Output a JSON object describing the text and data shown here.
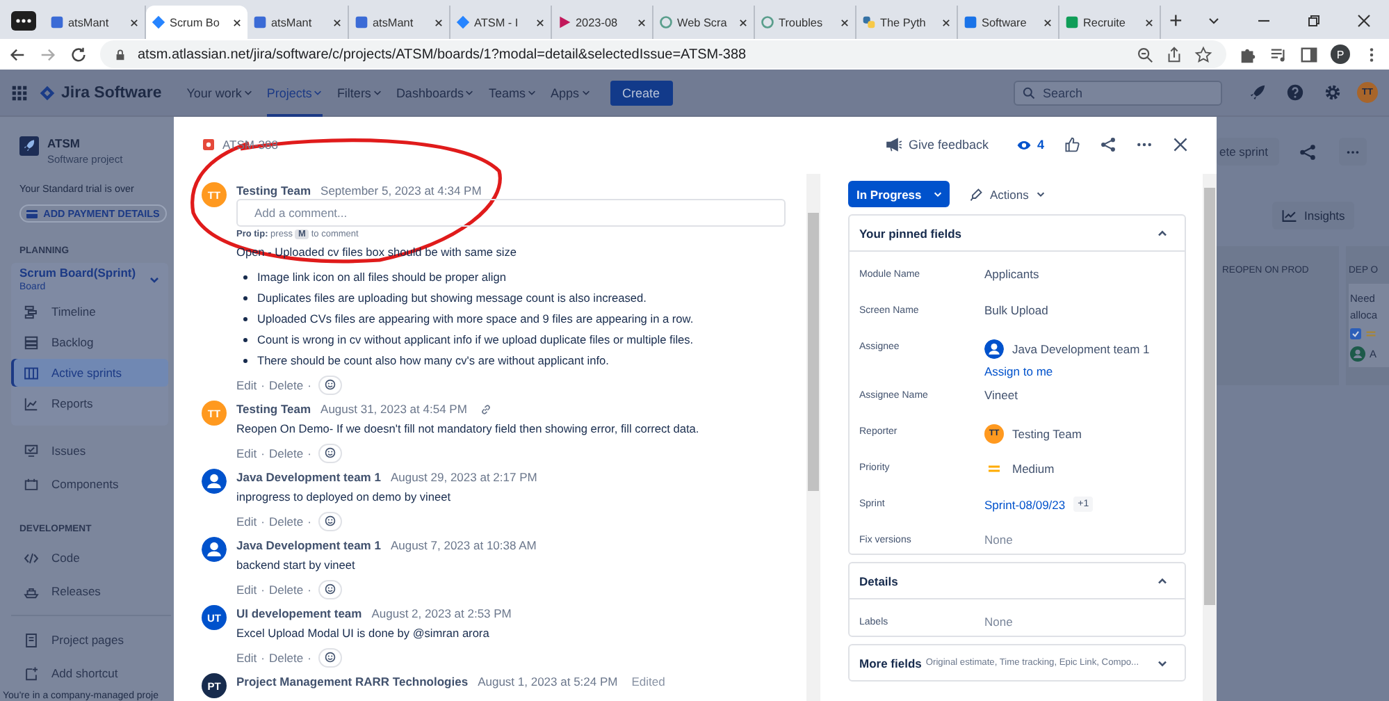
{
  "browser": {
    "tabs": [
      {
        "title": "atsMant",
        "kind": "m",
        "selected": false
      },
      {
        "title": "Scrum Bo",
        "kind": "jira",
        "selected": true
      },
      {
        "title": "atsMant",
        "kind": "m",
        "selected": false
      },
      {
        "title": "atsMant",
        "kind": "m",
        "selected": false
      },
      {
        "title": "ATSM - I",
        "kind": "jira",
        "selected": false
      },
      {
        "title": "2023-08",
        "kind": "triangle",
        "selected": false
      },
      {
        "title": "Web Scra",
        "kind": "knot",
        "selected": false
      },
      {
        "title": "Troubles",
        "kind": "knot",
        "selected": false
      },
      {
        "title": "The Pyth",
        "kind": "python",
        "selected": false
      },
      {
        "title": "Software",
        "kind": "video",
        "selected": false
      },
      {
        "title": "Recruite",
        "kind": "sheet",
        "selected": false
      }
    ],
    "new_tab": "+",
    "address": "atsm.atlassian.net/jira/software/c/projects/ATSM/boards/1?modal=detail&selectedIssue=ATSM-388",
    "profile": "P"
  },
  "topnav": {
    "product": "Jira Software",
    "menus": [
      {
        "label": "Your work",
        "selected": false
      },
      {
        "label": "Projects",
        "selected": true
      },
      {
        "label": "Filters",
        "selected": false
      },
      {
        "label": "Dashboards",
        "selected": false
      },
      {
        "label": "Teams",
        "selected": false
      },
      {
        "label": "Apps",
        "selected": false
      }
    ],
    "create": "Create",
    "search_placeholder": "Search",
    "avatar": "TT"
  },
  "sidebar": {
    "project": "ATSM",
    "project_type": "Software project",
    "trial": "Your Standard trial is over",
    "payment_button": "ADD PAYMENT DETAILS",
    "planning": {
      "heading": "PLANNING",
      "board": "Scrum Board(Sprint)",
      "board_type": "Board",
      "items": [
        {
          "label": "Timeline",
          "kind": "timeline",
          "selected": false
        },
        {
          "label": "Backlog",
          "kind": "backlog",
          "selected": false
        },
        {
          "label": "Active sprints",
          "kind": "board",
          "selected": true
        },
        {
          "label": "Reports",
          "kind": "reports",
          "selected": false
        }
      ]
    },
    "items": [
      {
        "label": "Issues",
        "kind": "issues",
        "selected": false
      },
      {
        "label": "Components",
        "kind": "components",
        "selected": false
      }
    ],
    "development": {
      "heading": "DEVELOPMENT",
      "items": [
        {
          "label": "Code",
          "kind": "code",
          "selected": false
        },
        {
          "label": "Releases",
          "kind": "releases",
          "selected": false
        }
      ]
    },
    "bottom_items": [
      {
        "label": "Project pages",
        "kind": "pages",
        "selected": false
      },
      {
        "label": "Add shortcut",
        "kind": "shortcut",
        "selected": false
      }
    ],
    "footer": "You're in a company-managed proje"
  },
  "board": {
    "complete_button": "ete sprint",
    "insights": "Insights",
    "columns": [
      {
        "title": "REOPEN ON PROD"
      },
      {
        "title": "DEP O",
        "card_lines": [
          "Need",
          "alloca"
        ],
        "card_checked": true,
        "card_assignee": "A"
      }
    ]
  },
  "issue": {
    "issue_key": "ATSM-388",
    "feedback": "Give feedback",
    "watchers": "4",
    "comment_box": {
      "placeholder": "Add a comment...",
      "tip_lead": "**Pro tip:** press",
      "tip_key": "M",
      "tip_tail": "to comment"
    },
    "separator": "·",
    "comments": [
      {
        "author": "Testing Team",
        "avatar": {
          "kind": "initials",
          "text": "TT",
          "color": "#ff991f"
        },
        "time": "September 5, 2023 at 4:34 PM",
        "link": false,
        "paragraphs": [
          "Open -  Uploaded cv files box should be with same size"
        ],
        "bullets": [
          "Image link icon on all files should be proper align",
          "Duplicates files are uploading but showing message count is also increased.",
          "Uploaded CVs files are appearing with more space and 9 files are appearing in a row.",
          "Count is wrong in cv without applicant info if we upload duplicate files or multiple files.",
          "There should be count also how many cv's are without applicant info."
        ],
        "actions": [
          "Edit",
          "Delete"
        ]
      },
      {
        "author": "Testing Team",
        "avatar": {
          "kind": "initials",
          "text": "TT",
          "color": "#ff991f"
        },
        "time": "August 31, 2023 at 4:54 PM",
        "link": true,
        "paragraphs": [
          "Reopen On Demo- If we doesn't fill not mandatory field then showing error, fill correct data."
        ],
        "actions": [
          "Edit",
          "Delete"
        ]
      },
      {
        "author": "Java Development team 1",
        "avatar": {
          "kind": "person",
          "color": "#0052cc"
        },
        "time": "August 29, 2023 at 2:17 PM",
        "link": false,
        "paragraphs": [
          "inprogress to deployed on demo by vineet"
        ],
        "actions": [
          "Edit",
          "Delete"
        ]
      },
      {
        "author": "Java Development team 1",
        "avatar": {
          "kind": "person",
          "color": "#0052cc"
        },
        "time": "August 7, 2023 at 10:38 AM",
        "link": false,
        "paragraphs": [
          "backend start by vineet"
        ],
        "actions": [
          "Edit",
          "Delete"
        ]
      },
      {
        "author": "UI developement team",
        "avatar": {
          "kind": "initials",
          "text": "UT",
          "color": "#0052cc"
        },
        "time": "August 2, 2023 at 2:53 PM",
        "link": false,
        "paragraphs": [
          "Excel Upload Modal UI is done by @simran arora"
        ],
        "actions": [
          "Edit",
          "Delete"
        ]
      },
      {
        "author": "Project Management RARR Technologies",
        "avatar": {
          "kind": "initials",
          "text": "PT",
          "color": "#172b4d"
        },
        "time": "August 1, 2023 at 5:24 PM",
        "link": false,
        "edited": "Edited"
      }
    ],
    "status": "In Progress",
    "actions_label": "Actions",
    "cards": [
      {
        "title": "Your pinned fields",
        "expanded": true,
        "fields": [
          {
            "label": "Module Name",
            "kind": "text",
            "value": "Applicants"
          },
          {
            "label": "Screen Name",
            "kind": "text",
            "value": "Bulk Upload"
          },
          {
            "label": "Assignee",
            "kind": "user",
            "value": "Java Development team 1",
            "avatar": {
              "kind": "person",
              "color": "#0052cc"
            },
            "link": "Assign to me"
          },
          {
            "label": "Assignee Name",
            "kind": "text",
            "value": "Vineet"
          },
          {
            "label": "Reporter",
            "kind": "user",
            "value": "Testing Team",
            "avatar": {
              "kind": "initials",
              "text": "TT",
              "color": "#ff991f"
            }
          },
          {
            "label": "Priority",
            "kind": "priority",
            "value": "Medium"
          },
          {
            "label": "Sprint",
            "kind": "link",
            "value": "Sprint-08/09/23",
            "badge": "+1"
          },
          {
            "label": "Fix versions",
            "kind": "none",
            "value": "None"
          }
        ]
      },
      {
        "title": "Details",
        "expanded": true,
        "fields": [
          {
            "label": "Labels",
            "kind": "none",
            "value": "None"
          }
        ]
      },
      {
        "title": "More fields",
        "summary": "Original estimate, Time tracking, Epic Link, Compo...",
        "expanded": false
      }
    ]
  }
}
